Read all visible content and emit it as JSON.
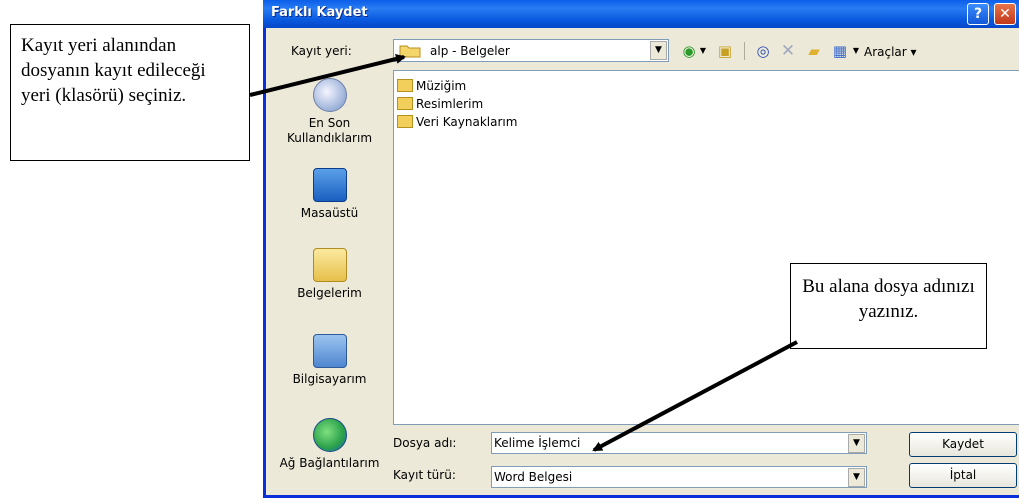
{
  "dialog": {
    "title": "Farklı Kaydet",
    "help_label": "?",
    "close_label": "✕"
  },
  "toolbar": {
    "look_in_label": "Kayıt yeri:",
    "look_in_value": "alp - Belgeler",
    "tools_label": "Araçlar ▾"
  },
  "places": [
    {
      "label": "En Son\nKullandıklarım",
      "icon": "recent-icon"
    },
    {
      "label": "Masaüstü",
      "icon": "desktop-icon"
    },
    {
      "label": "Belgelerim",
      "icon": "my-documents-icon"
    },
    {
      "label": "Bilgisayarım",
      "icon": "my-computer-icon"
    },
    {
      "label": "Ağ Bağlantılarım",
      "icon": "network-icon"
    }
  ],
  "files": [
    {
      "name": "Müziğim",
      "icon": "folder-icon"
    },
    {
      "name": "Resimlerim",
      "icon": "folder-icon"
    },
    {
      "name": "Veri Kaynaklarım",
      "icon": "folder-icon"
    }
  ],
  "form": {
    "file_name_label": "Dosya adı:",
    "file_name_value": "Kelime İşlemci",
    "file_type_label": "Kayıt türü:",
    "file_type_value": "Word Belgesi",
    "save_label": "Kaydet",
    "cancel_label": "İptal"
  },
  "annotations": {
    "left_note": "Kayıt yeri alanından dosyanın kayıt edileceği yeri (klasörü) seçiniz.",
    "right_note": "Bu alana dosya adınızı yazınız."
  }
}
